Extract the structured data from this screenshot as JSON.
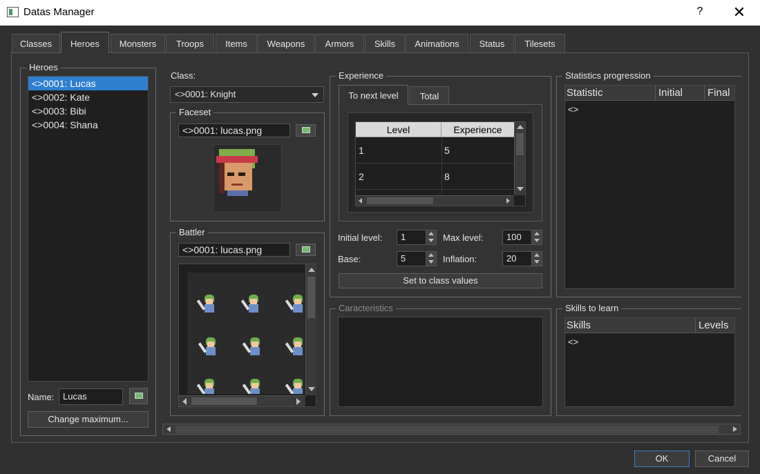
{
  "window": {
    "title": "Datas Manager",
    "help": "?",
    "close": "✕"
  },
  "tabs": [
    "Classes",
    "Heroes",
    "Monsters",
    "Troops",
    "Items",
    "Weapons",
    "Armors",
    "Skills",
    "Animations",
    "Status",
    "Tilesets"
  ],
  "heroes": {
    "title": "Heroes",
    "items": [
      "<>0001: Lucas",
      "<>0002: Kate",
      "<>0003: Bibi",
      "<>0004: Shana"
    ],
    "name_label": "Name:",
    "name_value": "Lucas",
    "change_max": "Change maximum..."
  },
  "class": {
    "label": "Class:",
    "value": "<>0001: Knight"
  },
  "faceset": {
    "title": "Faceset",
    "file": "<>0001: lucas.png"
  },
  "battler": {
    "title": "Battler",
    "file": "<>0001: lucas.png"
  },
  "experience": {
    "title": "Experience",
    "tab_next": "To next level",
    "tab_total": "Total",
    "col_level": "Level",
    "col_exp": "Experience",
    "rows": [
      {
        "level": "1",
        "exp": "5"
      },
      {
        "level": "2",
        "exp": "8"
      }
    ],
    "initial_level_label": "Initial level:",
    "initial_level": "1",
    "max_level_label": "Max level:",
    "max_level": "100",
    "base_label": "Base:",
    "base": "5",
    "inflation_label": "Inflation:",
    "inflation": "20",
    "set_class_values": "Set to class values"
  },
  "caracteristics": {
    "title": "Caracteristics"
  },
  "statistics": {
    "title": "Statistics progression",
    "col_stat": "Statistic",
    "col_initial": "Initial",
    "col_final": "Final",
    "row": "<>"
  },
  "skills": {
    "title": "Skills to learn",
    "col_skills": "Skills",
    "col_levels": "Levels",
    "row": "<>"
  },
  "footer": {
    "ok": "OK",
    "cancel": "Cancel"
  }
}
